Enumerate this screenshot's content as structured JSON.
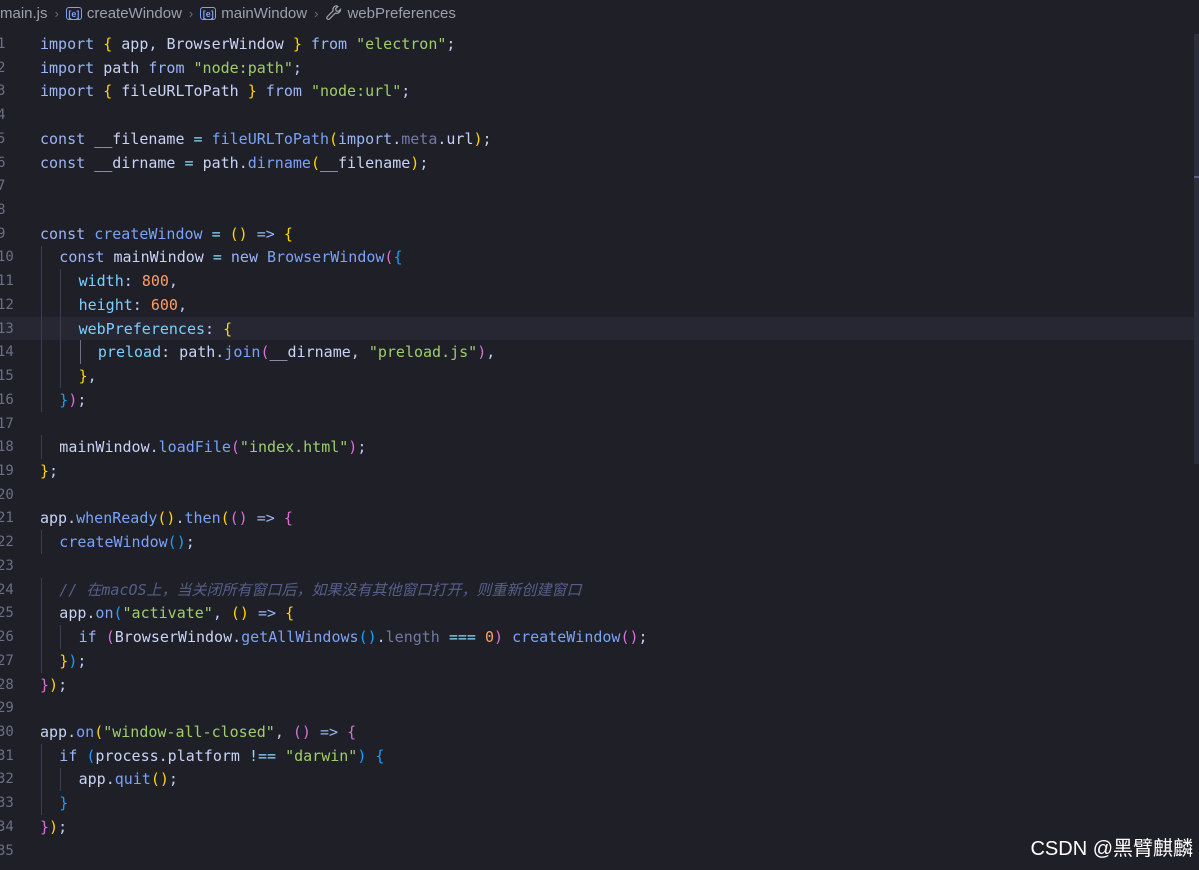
{
  "breadcrumb": {
    "file": "main.js",
    "items": [
      "createWindow",
      "mainWindow",
      "webPreferences"
    ],
    "item_icons": [
      "variable-icon",
      "variable-icon",
      "wrench-icon"
    ]
  },
  "editor": {
    "language": "javascript",
    "current_line": 13,
    "lines": [
      {
        "n": 1,
        "indent": 0,
        "t": [
          [
            "kw",
            "import "
          ],
          [
            "b1",
            "{ "
          ],
          [
            "var",
            "app"
          ],
          [
            "pun",
            ", "
          ],
          [
            "var",
            "BrowserWindow"
          ],
          [
            "b1",
            " }"
          ],
          [
            "kw",
            " from "
          ],
          [
            "str",
            "\"electron\""
          ],
          [
            "pun",
            ";"
          ]
        ]
      },
      {
        "n": 2,
        "indent": 0,
        "t": [
          [
            "kw",
            "import "
          ],
          [
            "var",
            "path"
          ],
          [
            "kw",
            " from "
          ],
          [
            "str",
            "\"node:path\""
          ],
          [
            "pun",
            ";"
          ]
        ]
      },
      {
        "n": 3,
        "indent": 0,
        "t": [
          [
            "kw",
            "import "
          ],
          [
            "b1",
            "{ "
          ],
          [
            "var",
            "fileURLToPath"
          ],
          [
            "b1",
            " }"
          ],
          [
            "kw",
            " from "
          ],
          [
            "str",
            "\"node:url\""
          ],
          [
            "pun",
            ";"
          ]
        ]
      },
      {
        "n": 4,
        "indent": 0,
        "t": []
      },
      {
        "n": 5,
        "indent": 0,
        "t": [
          [
            "kw",
            "const "
          ],
          [
            "var",
            "__filename"
          ],
          [
            "op",
            " = "
          ],
          [
            "fn",
            "fileURLToPath"
          ],
          [
            "b1",
            "("
          ],
          [
            "kw",
            "import"
          ],
          [
            "pun",
            "."
          ],
          [
            "dim",
            "meta"
          ],
          [
            "pun",
            "."
          ],
          [
            "var",
            "url"
          ],
          [
            "b1",
            ")"
          ],
          [
            "pun",
            ";"
          ]
        ]
      },
      {
        "n": 6,
        "indent": 0,
        "t": [
          [
            "kw",
            "const "
          ],
          [
            "var",
            "__dirname"
          ],
          [
            "op",
            " = "
          ],
          [
            "var",
            "path"
          ],
          [
            "pun",
            "."
          ],
          [
            "fn",
            "dirname"
          ],
          [
            "b1",
            "("
          ],
          [
            "var",
            "__filename"
          ],
          [
            "b1",
            ")"
          ],
          [
            "pun",
            ";"
          ]
        ]
      },
      {
        "n": 7,
        "indent": 0,
        "t": []
      },
      {
        "n": 8,
        "indent": 0,
        "t": []
      },
      {
        "n": 9,
        "indent": 0,
        "t": [
          [
            "kw",
            "const "
          ],
          [
            "fn",
            "createWindow"
          ],
          [
            "op",
            " = "
          ],
          [
            "b1",
            "() "
          ],
          [
            "kw",
            "=> "
          ],
          [
            "b1",
            "{"
          ]
        ]
      },
      {
        "n": 10,
        "indent": 1,
        "t": [
          [
            "kw",
            "const "
          ],
          [
            "var",
            "mainWindow"
          ],
          [
            "op",
            " = "
          ],
          [
            "kw",
            "new "
          ],
          [
            "fn",
            "BrowserWindow"
          ],
          [
            "b2",
            "("
          ],
          [
            "b3",
            "{"
          ]
        ]
      },
      {
        "n": 11,
        "indent": 2,
        "t": [
          [
            "prop",
            "width"
          ],
          [
            "pun",
            ": "
          ],
          [
            "num",
            "800"
          ],
          [
            "pun",
            ","
          ]
        ]
      },
      {
        "n": 12,
        "indent": 2,
        "t": [
          [
            "prop",
            "height"
          ],
          [
            "pun",
            ": "
          ],
          [
            "num",
            "600"
          ],
          [
            "pun",
            ","
          ]
        ]
      },
      {
        "n": 13,
        "indent": 2,
        "t": [
          [
            "prop",
            "webPreferences"
          ],
          [
            "pun",
            ": "
          ],
          [
            "b1",
            "{"
          ]
        ]
      },
      {
        "n": 14,
        "indent": 3,
        "t": [
          [
            "prop",
            "preload"
          ],
          [
            "pun",
            ": "
          ],
          [
            "var",
            "path"
          ],
          [
            "pun",
            "."
          ],
          [
            "fn",
            "join"
          ],
          [
            "b2",
            "("
          ],
          [
            "var",
            "__dirname"
          ],
          [
            "pun",
            ", "
          ],
          [
            "str",
            "\"preload.js\""
          ],
          [
            "b2",
            ")"
          ],
          [
            "pun",
            ","
          ]
        ]
      },
      {
        "n": 15,
        "indent": 2,
        "t": [
          [
            "b1",
            "}"
          ],
          [
            "pun",
            ","
          ]
        ]
      },
      {
        "n": 16,
        "indent": 1,
        "t": [
          [
            "b3",
            "}"
          ],
          [
            "b2",
            ")"
          ],
          [
            "pun",
            ";"
          ]
        ]
      },
      {
        "n": 17,
        "indent": 0,
        "t": []
      },
      {
        "n": 18,
        "indent": 1,
        "t": [
          [
            "var",
            "mainWindow"
          ],
          [
            "pun",
            "."
          ],
          [
            "fn",
            "loadFile"
          ],
          [
            "b2",
            "("
          ],
          [
            "str",
            "\"index.html\""
          ],
          [
            "b2",
            ")"
          ],
          [
            "pun",
            ";"
          ]
        ]
      },
      {
        "n": 19,
        "indent": 0,
        "t": [
          [
            "b1",
            "}"
          ],
          [
            "pun",
            ";"
          ]
        ]
      },
      {
        "n": 20,
        "indent": 0,
        "t": []
      },
      {
        "n": 21,
        "indent": 0,
        "t": [
          [
            "var",
            "app"
          ],
          [
            "pun",
            "."
          ],
          [
            "fn",
            "whenReady"
          ],
          [
            "b1",
            "()"
          ],
          [
            "pun",
            "."
          ],
          [
            "fn",
            "then"
          ],
          [
            "b1",
            "("
          ],
          [
            "b2",
            "() "
          ],
          [
            "kw",
            "=> "
          ],
          [
            "b2",
            "{"
          ]
        ]
      },
      {
        "n": 22,
        "indent": 1,
        "t": [
          [
            "fn",
            "createWindow"
          ],
          [
            "b3",
            "()"
          ],
          [
            "pun",
            ";"
          ]
        ]
      },
      {
        "n": 23,
        "indent": 0,
        "t": []
      },
      {
        "n": 24,
        "indent": 1,
        "t": [
          [
            "cmt",
            "// 在macOS上，当关闭所有窗口后，如果没有其他窗口打开，则重新创建窗口"
          ]
        ]
      },
      {
        "n": 25,
        "indent": 1,
        "t": [
          [
            "var",
            "app"
          ],
          [
            "pun",
            "."
          ],
          [
            "fn",
            "on"
          ],
          [
            "b3",
            "("
          ],
          [
            "str",
            "\"activate\""
          ],
          [
            "pun",
            ", "
          ],
          [
            "b1",
            "() "
          ],
          [
            "kw",
            "=> "
          ],
          [
            "b1",
            "{"
          ]
        ]
      },
      {
        "n": 26,
        "indent": 2,
        "t": [
          [
            "kw",
            "if "
          ],
          [
            "b2",
            "("
          ],
          [
            "var",
            "BrowserWindow"
          ],
          [
            "pun",
            "."
          ],
          [
            "fn",
            "getAllWindows"
          ],
          [
            "b3",
            "()"
          ],
          [
            "pun",
            "."
          ],
          [
            "dim",
            "length"
          ],
          [
            "op",
            " === "
          ],
          [
            "num",
            "0"
          ],
          [
            "b2",
            ")"
          ],
          [
            "fn",
            " createWindow"
          ],
          [
            "b2",
            "()"
          ],
          [
            "pun",
            ";"
          ]
        ]
      },
      {
        "n": 27,
        "indent": 1,
        "t": [
          [
            "b1",
            "}"
          ],
          [
            "b3",
            ")"
          ],
          [
            "pun",
            ";"
          ]
        ]
      },
      {
        "n": 28,
        "indent": 0,
        "t": [
          [
            "b2",
            "}"
          ],
          [
            "b1",
            ")"
          ],
          [
            "pun",
            ";"
          ]
        ]
      },
      {
        "n": 29,
        "indent": 0,
        "t": []
      },
      {
        "n": 30,
        "indent": 0,
        "t": [
          [
            "var",
            "app"
          ],
          [
            "pun",
            "."
          ],
          [
            "fn",
            "on"
          ],
          [
            "b1",
            "("
          ],
          [
            "str",
            "\"window-all-closed\""
          ],
          [
            "pun",
            ", "
          ],
          [
            "b2",
            "() "
          ],
          [
            "kw",
            "=> "
          ],
          [
            "b2",
            "{"
          ]
        ]
      },
      {
        "n": 31,
        "indent": 1,
        "t": [
          [
            "kw",
            "if "
          ],
          [
            "b3",
            "("
          ],
          [
            "var",
            "process"
          ],
          [
            "pun",
            "."
          ],
          [
            "var",
            "platform"
          ],
          [
            "op",
            " !== "
          ],
          [
            "str",
            "\"darwin\""
          ],
          [
            "b3",
            ")"
          ],
          [
            "b3",
            " {"
          ]
        ]
      },
      {
        "n": 32,
        "indent": 2,
        "t": [
          [
            "var",
            "app"
          ],
          [
            "pun",
            "."
          ],
          [
            "fn",
            "quit"
          ],
          [
            "b1",
            "()"
          ],
          [
            "pun",
            ";"
          ]
        ]
      },
      {
        "n": 33,
        "indent": 1,
        "t": [
          [
            "b3",
            "}"
          ]
        ]
      },
      {
        "n": 34,
        "indent": 0,
        "t": [
          [
            "b2",
            "}"
          ],
          [
            "b1",
            ")"
          ],
          [
            "pun",
            ";"
          ]
        ]
      },
      {
        "n": 35,
        "indent": 0,
        "t": []
      }
    ]
  },
  "watermark": "CSDN @黑臂麒麟",
  "colors": {
    "background": "#1f1f28",
    "keyword": "#9bb5f5",
    "string": "#9ece6a",
    "number": "#ff9e64",
    "function": "#7aa2f7",
    "property": "#7dcfff",
    "comment": "#565f89"
  }
}
